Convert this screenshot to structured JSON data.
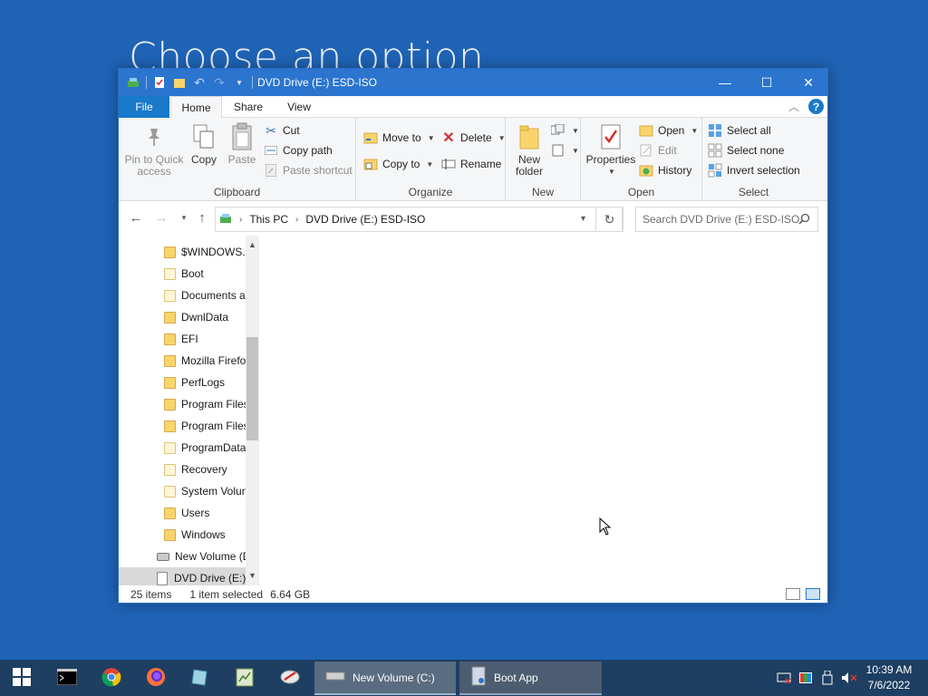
{
  "background": {
    "title": "Choose an option"
  },
  "window": {
    "title": "DVD Drive (E:) ESD-ISO",
    "controls": {
      "minimize": "—",
      "maximize": "☐",
      "close": "✕"
    }
  },
  "ribbon_tabs": [
    "File",
    "Home",
    "Share",
    "View"
  ],
  "ribbon": {
    "clipboard": {
      "label": "Clipboard",
      "pin": "Pin to Quick access",
      "pin_l1": "Pin to Quick",
      "pin_l2": "access",
      "copy": "Copy",
      "paste": "Paste",
      "cut": "Cut",
      "copy_path": "Copy path",
      "paste_shortcut": "Paste shortcut"
    },
    "organize": {
      "label": "Organize",
      "move_to": "Move to",
      "copy_to": "Copy to",
      "delete": "Delete",
      "rename": "Rename"
    },
    "new": {
      "label": "New",
      "new_folder_l1": "New",
      "new_folder_l2": "folder"
    },
    "open": {
      "label": "Open",
      "properties": "Properties",
      "open": "Open",
      "edit": "Edit",
      "history": "History"
    },
    "select": {
      "label": "Select",
      "select_all": "Select all",
      "select_none": "Select none",
      "invert": "Invert selection"
    }
  },
  "address": {
    "crumbs": [
      "This PC",
      "DVD Drive (E:) ESD-ISO"
    ],
    "search_placeholder": "Search DVD Drive (E:) ESD-ISO"
  },
  "nav_tree": [
    {
      "label": "$WINDOWS.~",
      "type": "folder"
    },
    {
      "label": "Boot",
      "type": "folder-pale"
    },
    {
      "label": "Documents a",
      "type": "folder-pale"
    },
    {
      "label": "DwnlData",
      "type": "folder"
    },
    {
      "label": "EFI",
      "type": "folder"
    },
    {
      "label": "Mozilla Firefo",
      "type": "folder"
    },
    {
      "label": "PerfLogs",
      "type": "folder"
    },
    {
      "label": "Program Files",
      "type": "folder"
    },
    {
      "label": "Program Files",
      "type": "folder"
    },
    {
      "label": "ProgramData",
      "type": "folder-pale"
    },
    {
      "label": "Recovery",
      "type": "folder-pale"
    },
    {
      "label": "System Volun",
      "type": "folder-pale"
    },
    {
      "label": "Users",
      "type": "folder"
    },
    {
      "label": "Windows",
      "type": "folder"
    },
    {
      "label": "New Volume (D",
      "type": "drive"
    },
    {
      "label": "DVD Drive (E:) I",
      "type": "disc"
    }
  ],
  "status": {
    "items": "25 items",
    "selected": "1 item selected",
    "size": "6.64 GB"
  },
  "taskbar": {
    "windows": [
      {
        "label": "New Volume (C:)"
      },
      {
        "label": "Boot App"
      }
    ],
    "time": "10:39 AM",
    "date": "7/6/2022"
  },
  "colors": {
    "titlebar": "#2b75cf",
    "desktop": "#1f63b5",
    "taskbar": "#1e3e62",
    "file_tab": "#1979ca"
  }
}
